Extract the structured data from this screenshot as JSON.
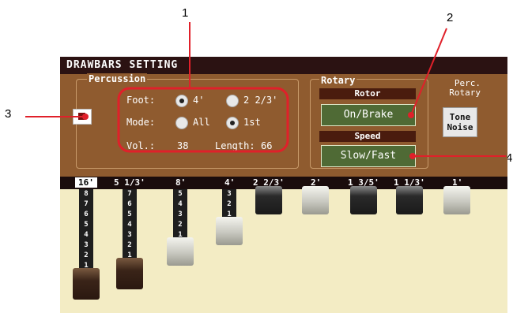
{
  "callouts": [
    "1",
    "2",
    "3",
    "4"
  ],
  "window": {
    "title": "DRAWBARS SETTING"
  },
  "percussion": {
    "title": "Percussion",
    "foot_label": "Foot:",
    "foot_options": [
      "4'",
      "2 2/3'"
    ],
    "foot_selected": "4'",
    "mode_label": "Mode:",
    "mode_options": [
      "All",
      "1st"
    ],
    "mode_selected": "1st",
    "vol_label": "Vol.:",
    "vol_value": "38",
    "length_label": "Length:",
    "length_value": "66"
  },
  "rotary": {
    "title": "Rotary",
    "rotor_header": "Rotor",
    "rotor_button": "On/Brake",
    "speed_header": "Speed",
    "speed_button": "Slow/Fast"
  },
  "side": {
    "label_line1": "Perc.",
    "label_line2": "Rotary",
    "tone_noise_line1": "Tone",
    "tone_noise_line2": "Noise"
  },
  "drawbars": [
    {
      "label": "16'",
      "level": 8,
      "numbers": "87654321",
      "selected": true
    },
    {
      "label": "5 1/3'",
      "level": 7,
      "numbers": "7654321",
      "selected": false
    },
    {
      "label": "8'",
      "level": 5,
      "numbers": "54321",
      "selected": false
    },
    {
      "label": "4'",
      "level": 3,
      "numbers": "321",
      "selected": false
    },
    {
      "label": "2 2/3'",
      "level": 0,
      "numbers": "",
      "selected": false
    },
    {
      "label": "2'",
      "level": 0,
      "numbers": "",
      "selected": false
    },
    {
      "label": "1 3/5'",
      "level": 0,
      "numbers": "",
      "selected": false
    },
    {
      "label": "1 1/3'",
      "level": 0,
      "numbers": "",
      "selected": false
    },
    {
      "label": "1'",
      "level": 0,
      "numbers": "",
      "selected": false
    }
  ],
  "colors": {
    "annotation_red": "#e0202a",
    "titlebar": "#2b1212",
    "panel": "#8f5b2f",
    "button_green": "#4f6a35"
  }
}
